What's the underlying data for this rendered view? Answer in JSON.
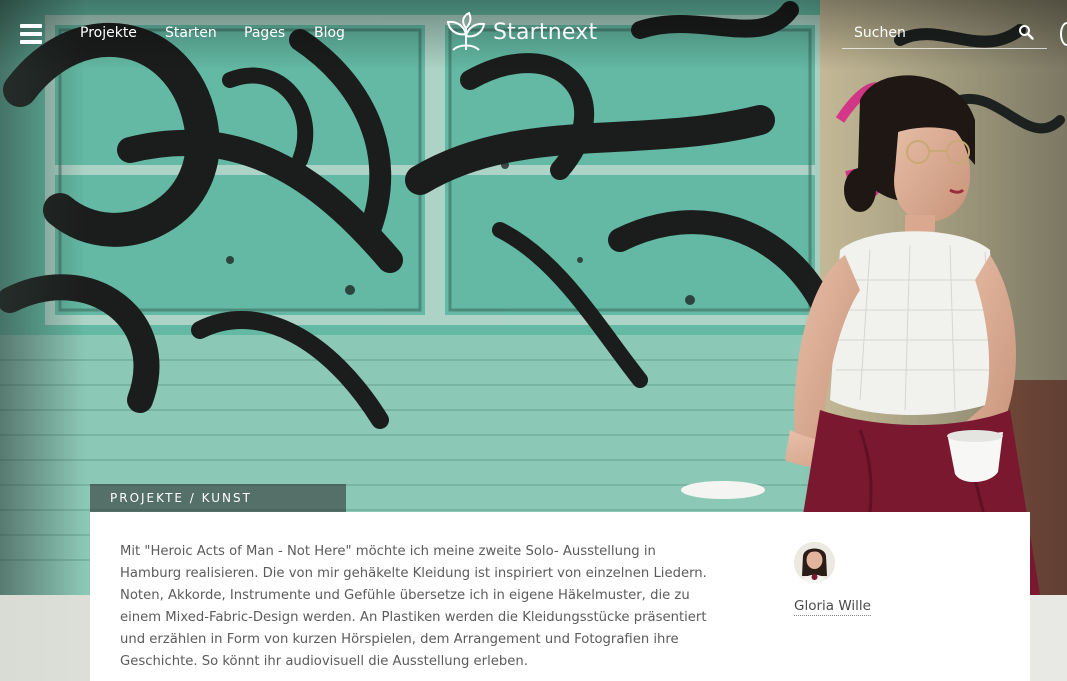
{
  "brand": {
    "name": "Startnext"
  },
  "nav": {
    "items": [
      "Projekte",
      "Starten",
      "Pages",
      "Blog"
    ]
  },
  "search": {
    "placeholder": "Suchen"
  },
  "project": {
    "category": "PROJEKTE / KUNST",
    "description": "Mit \"Heroic Acts of Man - Not Here\" möchte ich meine zweite Solo- Ausstellung in Hamburg realisieren. Die von mir gehäkelte Kleidung ist inspiriert von einzelnen Liedern. Noten, Akkorde, Instrumente und Gefühle übersetze ich in eigene Häkelmuster, die zu einem Mixed-Fabric-Design werden. An Plastiken werden die Kleidungsstücke präsentiert und erzählen in Form von kurzen Hörspielen, dem Arrangement und Fotografien ihre Geschichte. So könnt ihr audiovisuell die Ausstellung erleben.",
    "author": "Gloria Wille"
  },
  "icons": {
    "menu": "hamburger-menu-icon",
    "search": "search-icon",
    "logo": "sprout-logo-icon"
  },
  "colors": {
    "graffiti_green": "#5fb7a0",
    "paint_black": "#1b1d1c",
    "skirt_red": "#7a1830",
    "card_bg": "#ffffff"
  }
}
